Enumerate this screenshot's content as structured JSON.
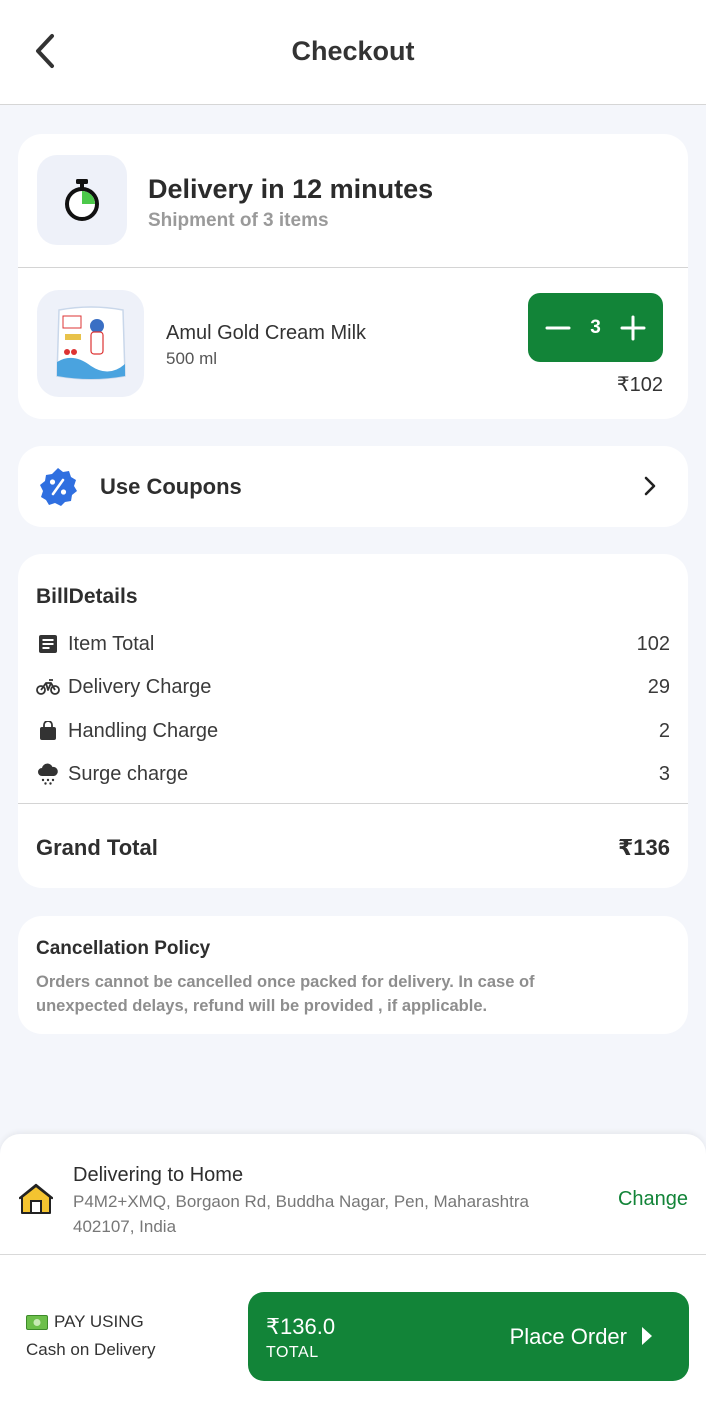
{
  "header": {
    "title": "Checkout"
  },
  "delivery": {
    "title": "Delivery in 12 minutes",
    "subtitle": "Shipment of 3 items",
    "item": {
      "name": "Amul Gold Cream Milk",
      "size": "500 ml",
      "quantity": "3",
      "price": "₹102"
    }
  },
  "coupons": {
    "label": "Use Coupons"
  },
  "bill": {
    "title": "BillDetails",
    "rows": [
      {
        "label": "Item Total",
        "value": "102",
        "icon": "receipt-icon"
      },
      {
        "label": "Delivery Charge",
        "value": "29",
        "icon": "bike-icon"
      },
      {
        "label": "Handling Charge",
        "value": "2",
        "icon": "bag-icon"
      },
      {
        "label": "Surge charge",
        "value": "3",
        "icon": "rain-cloud-icon"
      }
    ],
    "grand_total_label": "Grand Total",
    "grand_total_value": "₹136"
  },
  "policy": {
    "title": "Cancellation Policy",
    "text": "Orders cannot be cancelled once packed for delivery. In case of unexpected delays, refund will be provided , if applicable."
  },
  "address": {
    "title": "Delivering to Home",
    "line": " P4M2+XMQ, Borgaon Rd, Buddha Nagar, Pen, Maharashtra 402107, India",
    "change_label": "Change"
  },
  "payment": {
    "label": "PAY USING",
    "method": "Cash on Delivery",
    "amount": "₹136.0",
    "total_label": "TOTAL",
    "place_order_label": "Place Order"
  },
  "colors": {
    "primary_green": "#128438",
    "timer_green": "#4cc94a",
    "coupon_blue": "#2f6fe0",
    "home_yellow": "#f4c430"
  }
}
